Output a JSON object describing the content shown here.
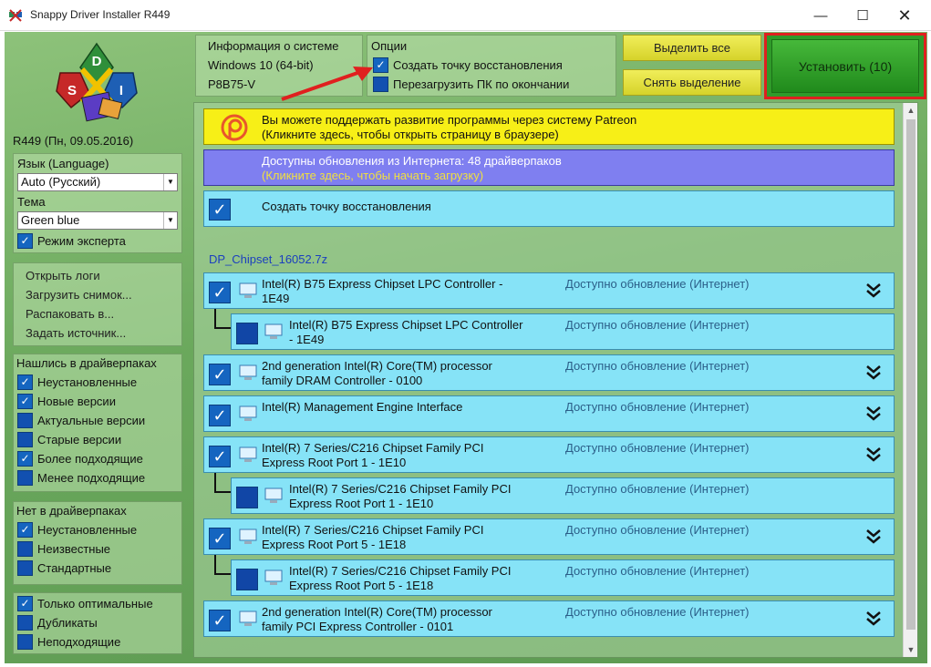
{
  "window": {
    "title": "Snappy Driver Installer R449",
    "minimize": "—",
    "maximize": "☐",
    "close": "✕"
  },
  "logo": {
    "letters": [
      "D",
      "S",
      "I"
    ]
  },
  "version": "R449 (Пн, 09.05.2016)",
  "language": {
    "label": "Язык (Language)",
    "value": "Auto (Русский)",
    "theme_label": "Тема",
    "theme_value": "Green blue",
    "expert_label": "Режим эксперта",
    "expert_checked": true
  },
  "menu": [
    "Открыть логи",
    "Загрузить снимок...",
    "Распаковать в...",
    "Задать источник..."
  ],
  "found_in_packs": {
    "title": "Нашлись в драйверпаках",
    "items": [
      {
        "label": "Неустановленные",
        "checked": true
      },
      {
        "label": "Новые версии",
        "checked": true
      },
      {
        "label": "Актуальные версии",
        "checked": false
      },
      {
        "label": "Старые версии",
        "checked": false
      },
      {
        "label": "Более подходящие",
        "checked": true
      },
      {
        "label": "Менее подходящие",
        "checked": false
      }
    ]
  },
  "missing_in_packs": {
    "title": "Нет в драйверпаках",
    "items": [
      {
        "label": "Неустановленные",
        "checked": true
      },
      {
        "label": "Неизвестные",
        "checked": false
      },
      {
        "label": "Стандартные",
        "checked": false
      }
    ]
  },
  "filter_options": [
    {
      "label": "Только оптимальные",
      "checked": true
    },
    {
      "label": "Дубликаты",
      "checked": false
    },
    {
      "label": "Неподходящие",
      "checked": false
    }
  ],
  "sysinfo": {
    "title": "Информация о системе",
    "os": "Windows 10 (64-bit)",
    "board": "P8B75-V"
  },
  "options": {
    "title": "Опции",
    "items": [
      {
        "label": "Создать точку восстановления",
        "checked": true
      },
      {
        "label": "Перезагрузить ПК по окончании",
        "checked": false
      }
    ]
  },
  "buttons": {
    "select_all": "Выделить все",
    "deselect": "Снять выделение",
    "install": "Установить (10)"
  },
  "patreon": {
    "line1": "Вы можете поддержать развитие программы через систему Patreon",
    "line2": "(Кликните здесь, чтобы открыть страницу в браузере)"
  },
  "updates": {
    "line1": "Доступны обновления из Интернета: 48 драйверпаков",
    "line2": "(Кликните здесь, чтобы начать загрузку)"
  },
  "restore_point": {
    "label": "Создать точку восстановления",
    "checked": true
  },
  "group": "DP_Chipset_16052.7z",
  "drivers": [
    {
      "line1": "Intel(R) B75 Express Chipset LPC Controller -",
      "line2": "1E49",
      "status": "Доступно обновление (Интернет)",
      "checked": true,
      "child": false
    },
    {
      "line1": "Intel(R) B75 Express Chipset LPC Controller",
      "line2": "- 1E49",
      "status": "Доступно обновление (Интернет)",
      "checked": false,
      "child": true
    },
    {
      "line1": "2nd generation Intel(R) Core(TM) processor",
      "line2": "family DRAM Controller - 0100",
      "status": "Доступно обновление (Интернет)",
      "checked": true,
      "child": false
    },
    {
      "line1": "Intel(R) Management Engine Interface",
      "line2": "",
      "status": "Доступно обновление (Интернет)",
      "checked": true,
      "child": false
    },
    {
      "line1": "Intel(R) 7 Series/C216 Chipset Family PCI",
      "line2": "Express Root Port 1 - 1E10",
      "status": "Доступно обновление (Интернет)",
      "checked": true,
      "child": false
    },
    {
      "line1": "Intel(R) 7 Series/C216 Chipset Family PCI",
      "line2": "Express Root Port 1 - 1E10",
      "status": "Доступно обновление (Интернет)",
      "checked": false,
      "child": true
    },
    {
      "line1": "Intel(R) 7 Series/C216 Chipset Family PCI",
      "line2": "Express Root Port 5 - 1E18",
      "status": "Доступно обновление (Интернет)",
      "checked": true,
      "child": false
    },
    {
      "line1": "Intel(R) 7 Series/C216 Chipset Family PCI",
      "line2": "Express Root Port 5 - 1E18",
      "status": "Доступно обновление (Интернет)",
      "checked": false,
      "child": true
    },
    {
      "line1": "2nd generation Intel(R) Core(TM) processor",
      "line2": "family PCI Express Controller - 0101",
      "status": "Доступно обновление (Интернет)",
      "checked": true,
      "child": false
    }
  ],
  "colors": {
    "accent": "#1565c0",
    "install_frame": "#e0201f",
    "row_bg": "#86e3f7",
    "patreon_bg": "#f7ef17",
    "updates_bg": "#7f7ff0"
  }
}
